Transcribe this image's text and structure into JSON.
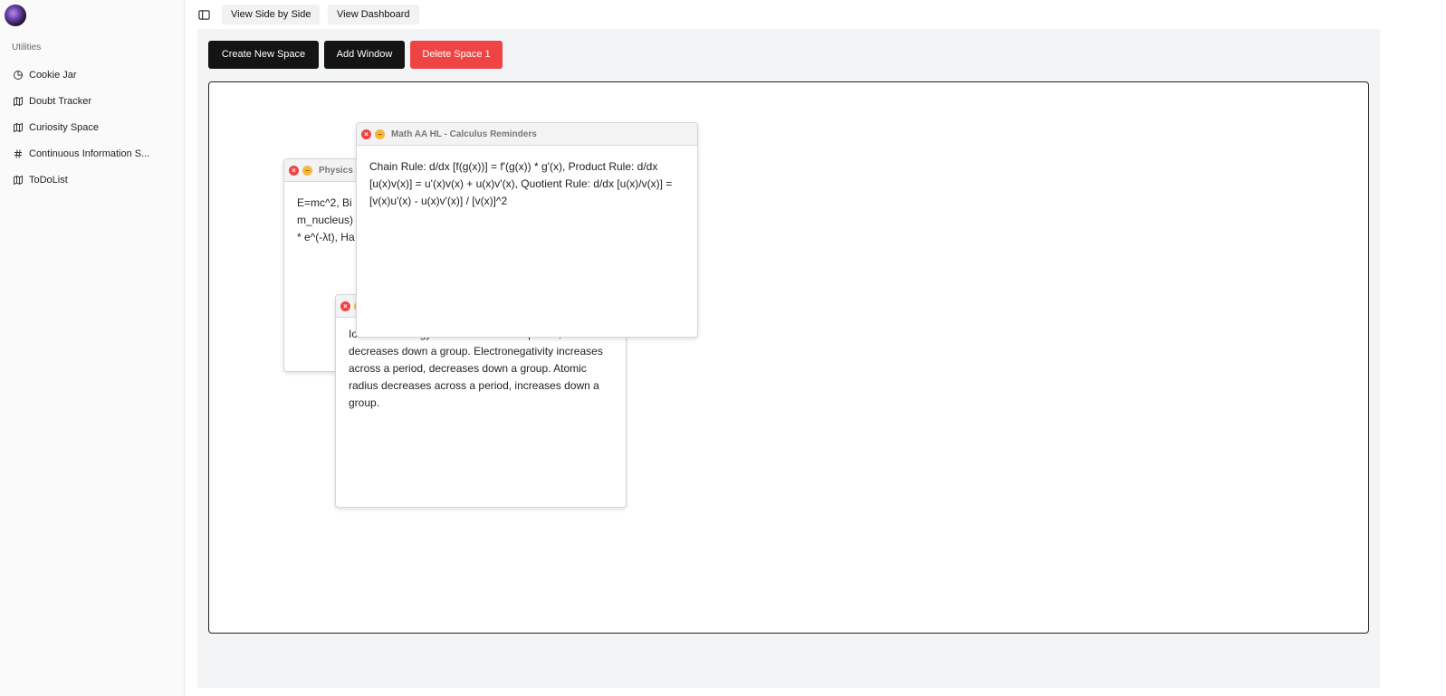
{
  "sidebar": {
    "group_label": "Utilities",
    "items": [
      {
        "label": "Cookie Jar",
        "icon": "pie-chart-icon"
      },
      {
        "label": "Doubt Tracker",
        "icon": "map-icon"
      },
      {
        "label": "Curiosity Space",
        "icon": "map-icon"
      },
      {
        "label": "Continuous Information S...",
        "icon": "hash-icon"
      },
      {
        "label": "ToDoList",
        "icon": "map-icon"
      }
    ]
  },
  "topbar": {
    "side_by_side": "View Side by Side",
    "dashboard": "View Dashboard"
  },
  "toolbar": {
    "create_space": "Create New Space",
    "add_window": "Add Window",
    "delete_space": "Delete Space 1"
  },
  "windows": {
    "physics": {
      "title": "Physics H",
      "content": "E=mc^2, Bi\nm_nucleus)\n* e^(-λt), Ha"
    },
    "chemistry": {
      "title": "",
      "content": "Ionization energy increases across a period, decreases down a group. Electronegativity increases across a period, decreases down a group. Atomic radius decreases across a period, increases down a group."
    },
    "math": {
      "title": "Math AA HL - Calculus Reminders",
      "content": "Chain Rule: d/dx [f(g(x))] = f'(g(x)) * g'(x), Product Rule: d/dx [u(x)v(x)] = u'(x)v(x) + u(x)v'(x), Quotient Rule: d/dx [u(x)/v(x)] = [v(x)u'(x) - u(x)v'(x)] / [v(x)]^2"
    }
  },
  "colors": {
    "primary_button": "#141414",
    "danger_button": "#ef4444",
    "close_dot": "#ef4444",
    "minimize_dot": "#f6b73c"
  }
}
